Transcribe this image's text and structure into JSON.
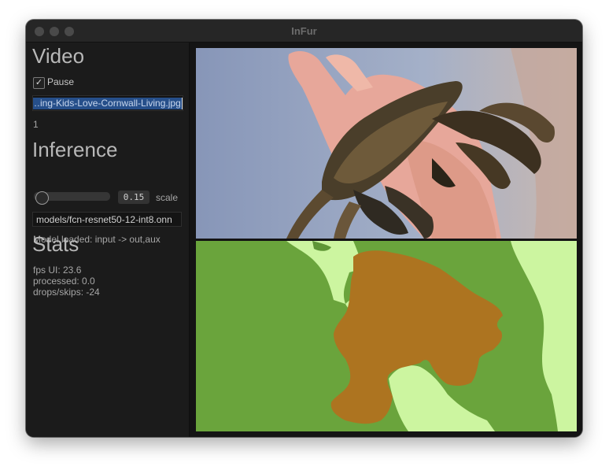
{
  "window": {
    "title": "InFur"
  },
  "video": {
    "heading": "Video",
    "pause_label": "Pause",
    "pause_checked": true,
    "file_path_visible": "…ing-Kids-Love-Cornwall-Living.jpg",
    "frame_counter": "1"
  },
  "inference": {
    "heading": "Inference",
    "scale_value": "0.15",
    "scale_label": "scale",
    "model_path_visible": "models/fcn-resnet50-12-int8.onn",
    "model_status": "Model loaded: input -> out,aux"
  },
  "stats": {
    "heading": "Stats",
    "fps_ui": "fps UI: 23.6",
    "processed": "processed: 0.0",
    "drops_skips": "drops/skips: -24"
  },
  "colors": {
    "seg_background": "#6aa43c",
    "seg_person": "#ccf5a0",
    "seg_crab": "#ad7420"
  },
  "icons": {
    "checkbox": "check-icon"
  }
}
